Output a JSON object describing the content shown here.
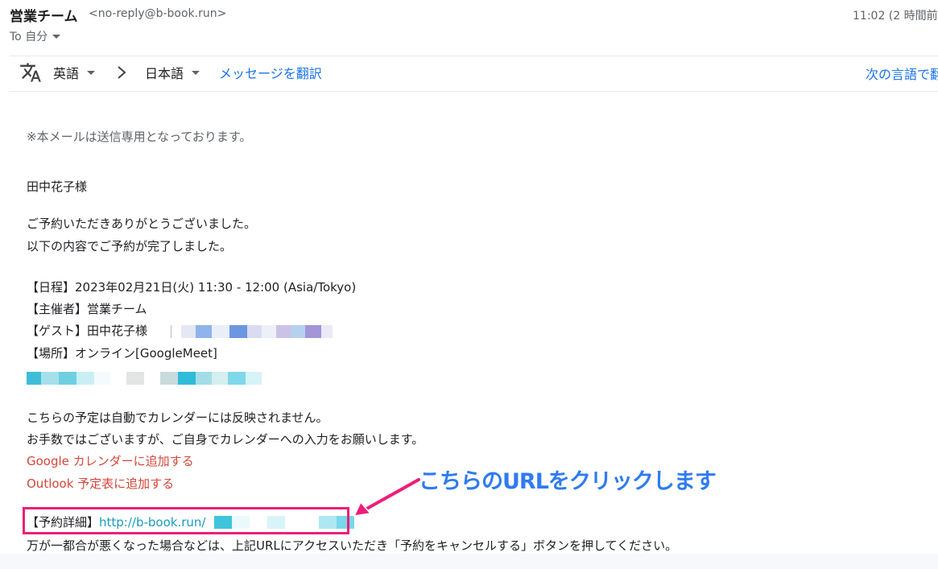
{
  "header": {
    "sender_name": "営業チーム",
    "sender_email": "<no-reply@b-book.run>",
    "time": "11:02 (2 時間前",
    "to_label": "To 自分"
  },
  "translate_bar": {
    "source_lang": "英語",
    "target_lang": "日本語",
    "translate_link": "メッセージを翻訳",
    "next_lang": "次の言語で翻"
  },
  "email": {
    "notice": "※本メールは送信専用となっております。",
    "recipient": "田中花子様",
    "thanks": "ご予約いただきありがとうございました。",
    "completed": "以下の内容でご予約が完了しました。",
    "schedule": "【日程】2023年02月21日(火) 11:30 - 12:00 (Asia/Tokyo)",
    "organizer": "【主催者】営業チーム",
    "guest": "【ゲスト】田中花子様",
    "place": "【場所】オンライン[GoogleMeet]",
    "calendar_note1": "こちらの予定は自動でカレンダーには反映されません。",
    "calendar_note2": "お手数ではございますが、ご自身でカレンダーへの入力をお願いします。",
    "google_link": "Google カレンダーに追加する",
    "outlook_link": "Outlook 予定表に追加する",
    "detail_label": "【予約詳細】",
    "detail_url": "http://b-book.run/",
    "cancel_note": "万が一都合が悪くなった場合などは、上記URLにアクセスいただき「予約をキャンセルする」ボタンを押してください。"
  },
  "annotation": {
    "callout": "こちらのURLをクリックします",
    "accent_color": "#ec1f7a"
  }
}
